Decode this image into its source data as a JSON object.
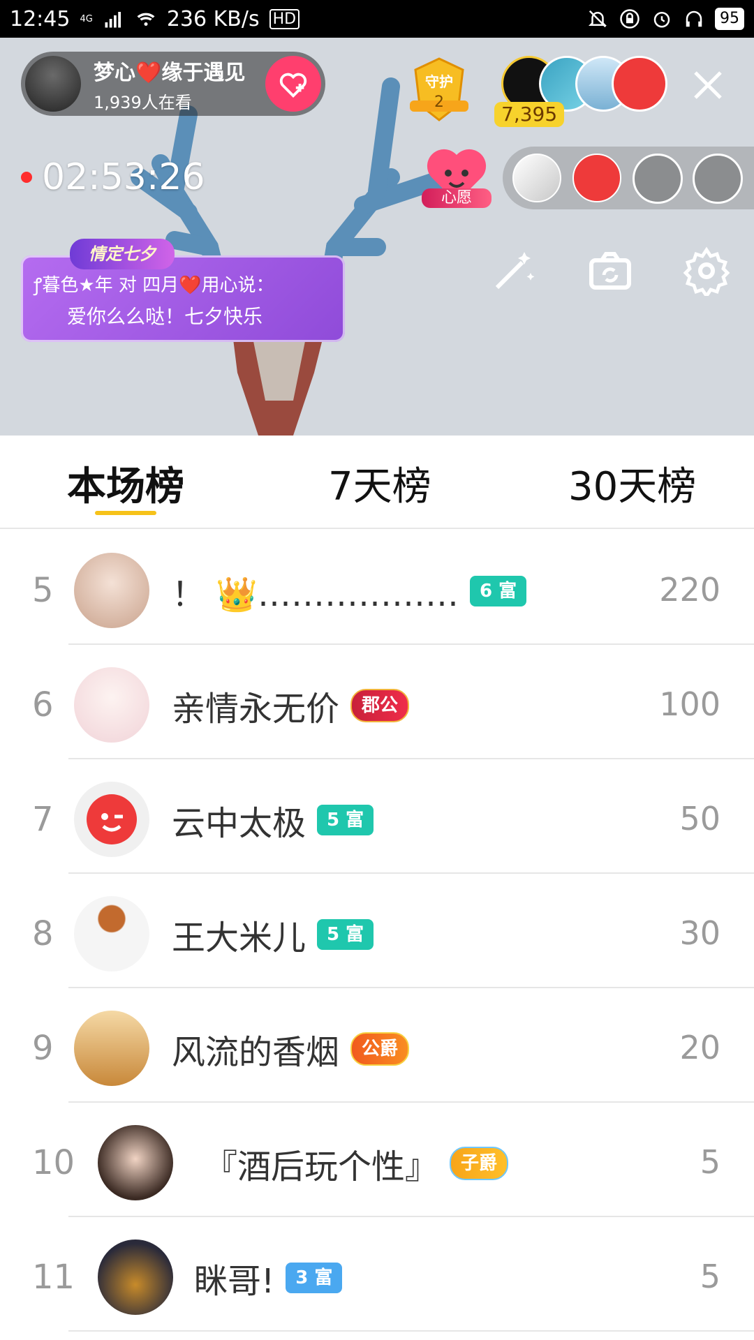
{
  "status_bar": {
    "time": "12:45",
    "network": "4G",
    "speed": "236 KB/s",
    "hd": "HD",
    "battery": "95"
  },
  "live": {
    "host_name": "梦心❤️缘于遇见",
    "viewers": "1,939人在看",
    "guard_label": "守护",
    "guard_count": "2",
    "score": "7,395",
    "timer": "02:53:26",
    "wish_label": "心愿",
    "banner_tag": "情定七夕",
    "banner_line1": "ꝭ暮色★年 对 四月❤️用心说：",
    "banner_line2": "爱你么么哒！七夕快乐"
  },
  "tabs": [
    {
      "label": "本场榜"
    },
    {
      "label": "7天榜"
    },
    {
      "label": "30天榜"
    }
  ],
  "ranking": [
    {
      "rank": "5",
      "name": "！ 👑………………",
      "badge": "6 富",
      "badge_style": "teal",
      "score": "220"
    },
    {
      "rank": "6",
      "name": "亲情永无价",
      "badge": "郡公",
      "badge_style": "red",
      "score": "100"
    },
    {
      "rank": "7",
      "name": "云中太极",
      "badge": "5 富",
      "badge_style": "teal",
      "score": "50"
    },
    {
      "rank": "8",
      "name": "王大米儿",
      "badge": "5 富",
      "badge_style": "teal",
      "score": "30"
    },
    {
      "rank": "9",
      "name": "风流的香烟",
      "badge": "公爵",
      "badge_style": "orange",
      "score": "20"
    },
    {
      "rank": "10",
      "name": "『酒后玩个性』",
      "badge": "子爵",
      "badge_style": "gold",
      "score": "5"
    },
    {
      "rank": "11",
      "name": "眯哥!",
      "badge": "3 富",
      "badge_style": "blue",
      "score": "5"
    }
  ],
  "colors": {
    "accent_yellow": "#f6c21a",
    "teal_badge": "#1fc7ad",
    "follow_pink": "#ff3f6e"
  },
  "icons": [
    "wifi-icon",
    "signal-icon",
    "bell-off-icon",
    "lock-icon",
    "alarm-icon",
    "headphones-icon",
    "heart-plus-icon",
    "close-icon",
    "magic-wand-icon",
    "camera-switch-icon",
    "settings-icon",
    "sofa-seat-icon"
  ]
}
